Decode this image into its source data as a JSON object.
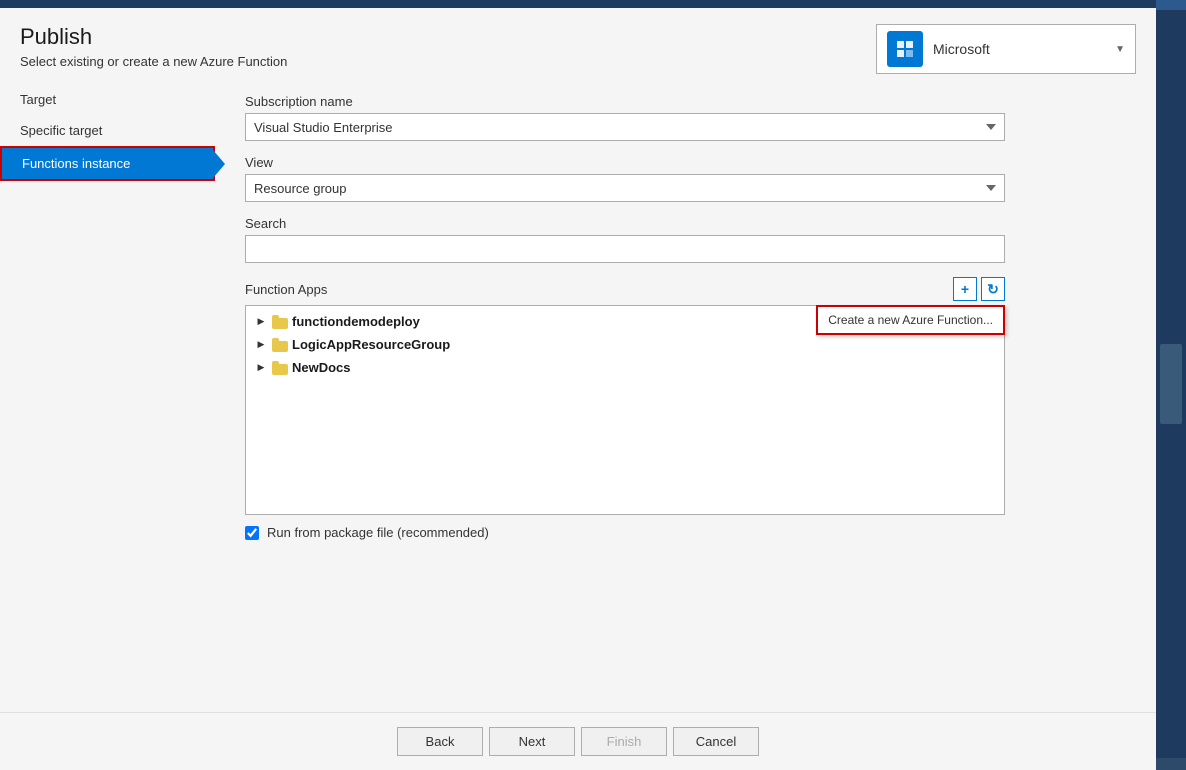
{
  "header": {
    "title": "Publish",
    "subtitle": "Select existing or create a new Azure Function",
    "top_bar_color": "#1e3a5f"
  },
  "account": {
    "name": "Microsoft",
    "icon": "👤"
  },
  "nav": {
    "items": [
      {
        "id": "target",
        "label": "Target",
        "active": false
      },
      {
        "id": "specific-target",
        "label": "Specific target",
        "active": false
      },
      {
        "id": "functions-instance",
        "label": "Functions instance",
        "active": true
      }
    ]
  },
  "form": {
    "subscription_label": "Subscription name",
    "subscription_value": "Visual Studio Enterprise",
    "view_label": "View",
    "view_value": "Resource group",
    "search_label": "Search",
    "search_placeholder": "",
    "function_apps_label": "Function Apps",
    "add_btn_label": "+",
    "refresh_btn_label": "↻",
    "create_tooltip": "Create a new Azure Function...",
    "tree_items": [
      {
        "label": "functiondemodeploy"
      },
      {
        "label": "LogicAppResourceGroup"
      },
      {
        "label": "NewDocs"
      }
    ],
    "checkbox_label": "Run from package file (recommended)",
    "checkbox_checked": true
  },
  "footer": {
    "back_label": "Back",
    "next_label": "Next",
    "finish_label": "Finish",
    "cancel_label": "Cancel"
  }
}
